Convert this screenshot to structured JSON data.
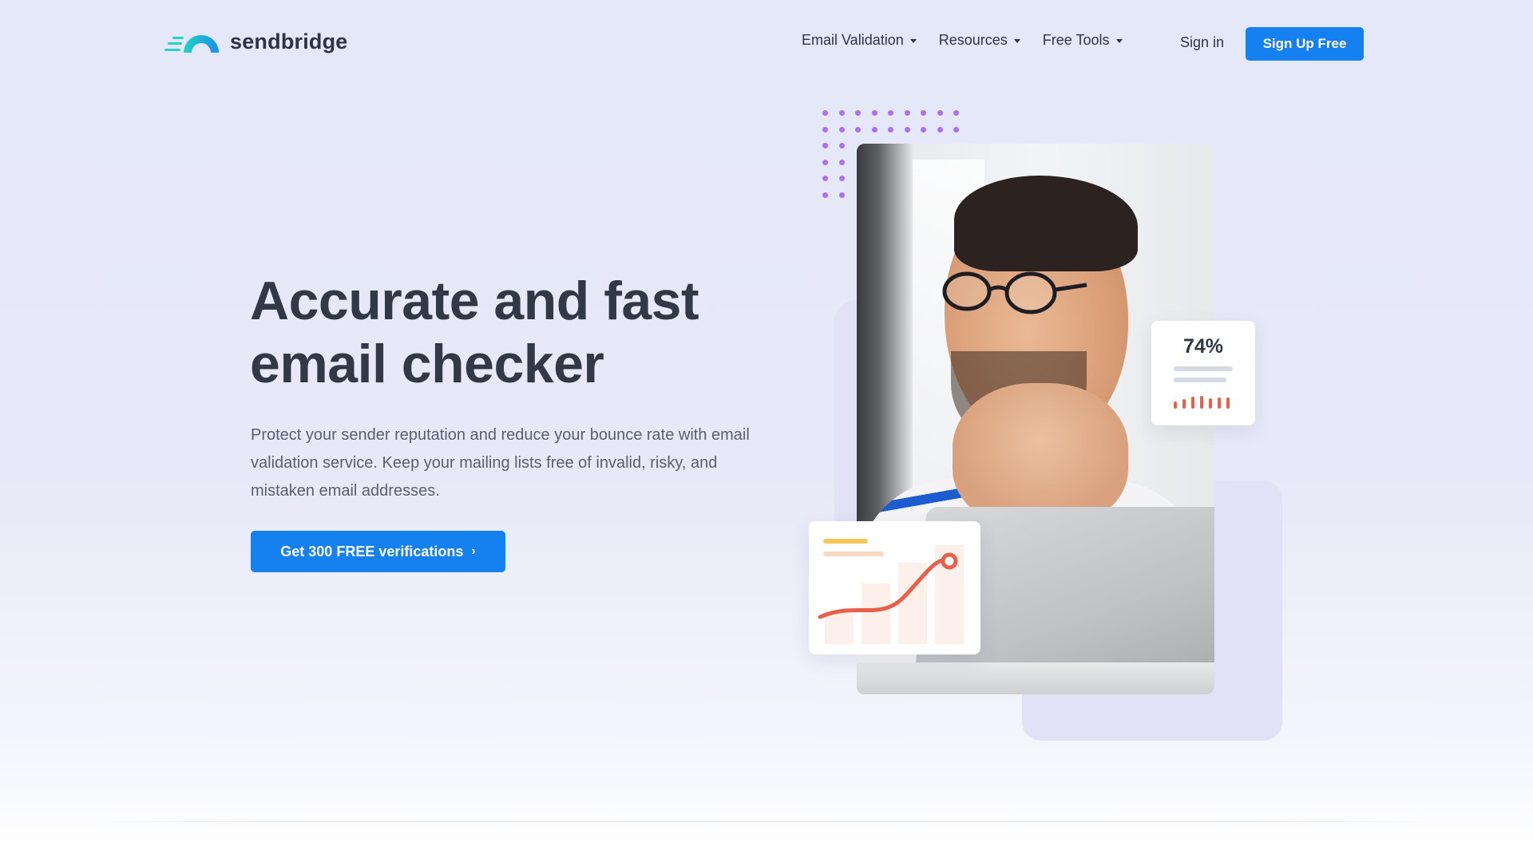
{
  "brand": {
    "name": "sendbridge",
    "logo_icon": "arch-speed-icon",
    "accent": "#1580f0",
    "logo_teal": "#1ec8d8"
  },
  "nav": {
    "items": [
      {
        "label": "Email Validation",
        "has_dropdown": true
      },
      {
        "label": "Resources",
        "has_dropdown": true
      },
      {
        "label": "Free Tools",
        "has_dropdown": true
      }
    ],
    "signin_label": "Sign in",
    "signup_label": "Sign Up Free"
  },
  "hero": {
    "headline_line1": "Accurate and fast",
    "headline_line2": "email checker",
    "subtext": "Protect your sender reputation and reduce your bounce rate with email validation service. Keep your mailing lists free of invalid, risky, and mistaken email addresses.",
    "cta_label": "Get 300 FREE verifications",
    "cta_icon": "chevron-right-icon"
  },
  "illustration": {
    "stat_value": "74%",
    "stat_bar_heights": [
      0.55,
      0.75,
      0.95,
      1.0,
      0.8,
      0.85,
      0.9
    ],
    "chart_trend": "rising",
    "photo_subject": "smiling man with glasses at laptop"
  }
}
